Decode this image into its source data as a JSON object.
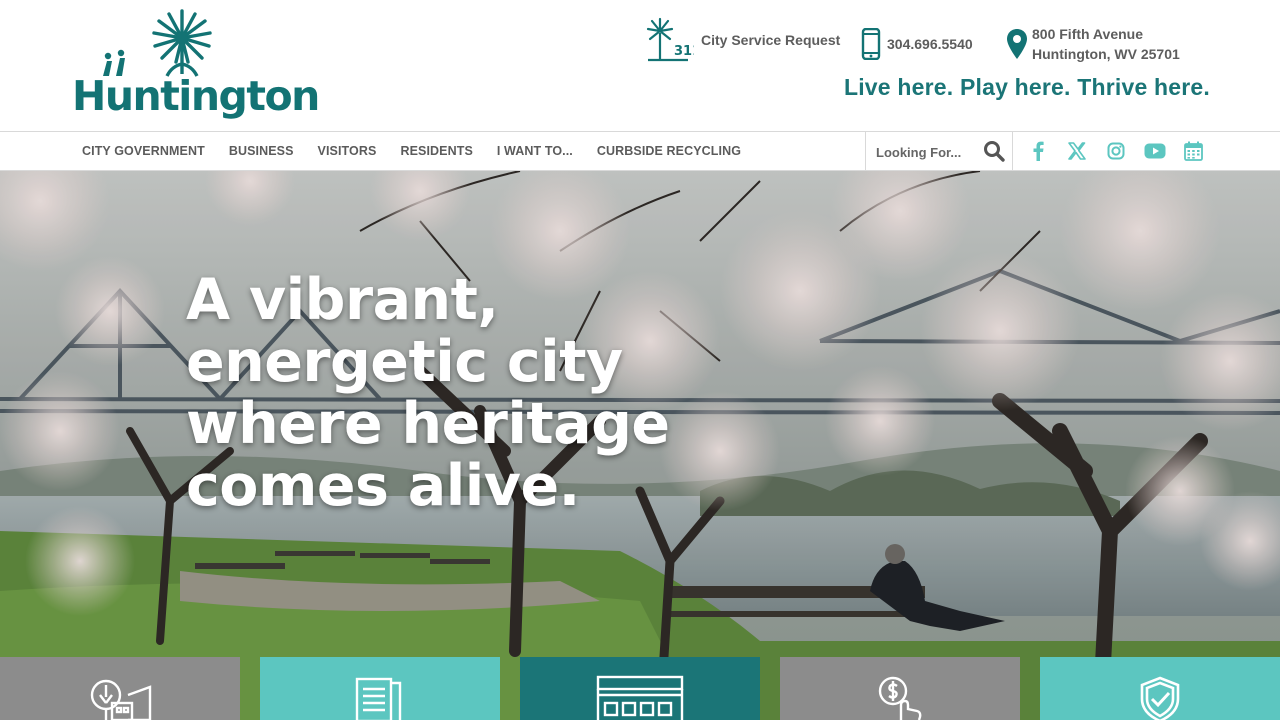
{
  "header": {
    "logo_text": "Huntington",
    "service_request": {
      "badge": "311",
      "label": "City Service Request"
    },
    "phone": "304.696.5540",
    "address": {
      "line1": "800 Fifth Avenue",
      "line2": "Huntington, WV 25701"
    },
    "tagline": "Live here. Play here. Thrive here."
  },
  "nav": {
    "items": [
      {
        "label": "CITY GOVERNMENT"
      },
      {
        "label": "BUSINESS"
      },
      {
        "label": "VISITORS"
      },
      {
        "label": "RESIDENTS"
      },
      {
        "label": "I WANT TO..."
      },
      {
        "label": "CURBSIDE RECYCLING"
      }
    ],
    "search": {
      "placeholder": "Looking For..."
    },
    "social_icons": [
      "facebook-icon",
      "x-icon",
      "instagram-icon",
      "youtube-icon",
      "calendar-icon"
    ]
  },
  "hero": {
    "heading": "A vibrant, energetic city where heritage comes alive."
  },
  "tiles": [
    {
      "icon": "community-building-icon",
      "color": "#8c8c8c"
    },
    {
      "icon": "documents-icon",
      "color": "#5cc6c0"
    },
    {
      "icon": "storefront-icon",
      "color": "#1b7577"
    },
    {
      "icon": "pay-bill-icon",
      "color": "#8c8c8c"
    },
    {
      "icon": "shield-check-icon",
      "color": "#5cc6c0"
    }
  ],
  "colors": {
    "brand_teal": "#137374",
    "tagline": "#1b7577",
    "light_teal": "#5cc6c0",
    "gray": "#8c8c8c"
  }
}
